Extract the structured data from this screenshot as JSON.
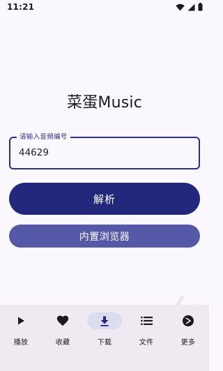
{
  "status_bar": {
    "time": "11:21",
    "icons": [
      "wifi-icon",
      "signal-icon",
      "battery-icon"
    ]
  },
  "app": {
    "title": "菜蛋Music"
  },
  "search": {
    "label": "请输入音频编号",
    "value": "44629"
  },
  "actions": {
    "parse_label": "解析",
    "browser_label": "内置浏览器"
  },
  "bottom_nav": {
    "items": [
      {
        "label": "播放",
        "icon": "play-icon",
        "active": false
      },
      {
        "label": "收藏",
        "icon": "heart-icon",
        "active": false
      },
      {
        "label": "下载",
        "icon": "download-icon",
        "active": true
      },
      {
        "label": "文件",
        "icon": "list-icon",
        "active": false
      },
      {
        "label": "更多",
        "icon": "more-icon",
        "active": false
      }
    ]
  },
  "colors": {
    "primary": "#23287c",
    "secondary": "#5558a6",
    "field_border": "#2c2f86",
    "background": "#fbf8fd",
    "nav_background": "#efeaf2",
    "nav_active_pill": "#dcdcf0"
  }
}
